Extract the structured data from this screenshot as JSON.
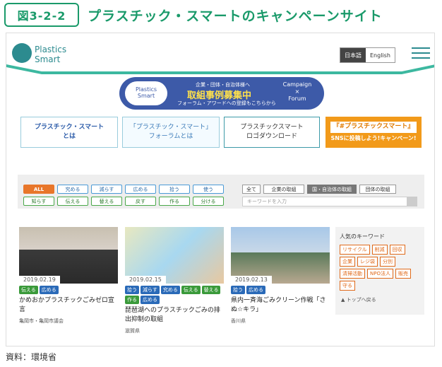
{
  "figure": {
    "label": "図3-2-2",
    "title": "プラスチック・スマートのキャンペーンサイト",
    "source": "資料：環境省"
  },
  "header": {
    "logo_line1": "Plastics",
    "logo_line2": "Smart",
    "lang": [
      "日本語",
      "English"
    ]
  },
  "banner": {
    "line1": "企業・団体・自治体様へ",
    "line2": "取組事例募集中",
    "line3": "フォーラム・アワードへの登録もこちらから",
    "logo1": "Plastics",
    "logo2": "Smart",
    "right1": "Campaign",
    "right2": "×",
    "right3": "Forum"
  },
  "tiles": [
    {
      "line1": "プラスチック・スマート",
      "line2": "とは"
    },
    {
      "line1": "「プラスチック・スマート」",
      "line2": "フォーラムとは"
    },
    {
      "line1": "プラスチックスマート",
      "line2": "ロゴダウンロード"
    },
    {
      "line1": "『#プラスチックスマート』",
      "line2": "SNSに投稿しよう!キャンペーン!"
    }
  ],
  "filters": {
    "row1": [
      "ALL",
      "究める",
      "減らす",
      "広める",
      "拾う",
      "使う"
    ],
    "row2": [
      "知らす",
      "伝える",
      "替える",
      "戻す",
      "作る",
      "分ける"
    ],
    "categories": [
      "全て",
      "企業の取組",
      "国・自治体の取組",
      "団体の取組"
    ],
    "keyword_placeholder": "キーワードを入力"
  },
  "cards": [
    {
      "date": "2019.02.19",
      "tags": [
        "伝える",
        "広める"
      ],
      "title": "かめおかプラスチックごみゼロ宣言",
      "org": "亀岡市・亀岡市議会"
    },
    {
      "date": "2019.02.15",
      "tags": [
        "拾う",
        "減らす",
        "究める",
        "伝える",
        "替える",
        "作る",
        "広める"
      ],
      "title": "琵琶湖へのプラスチックごみの排出抑制の取組",
      "org": "滋賀県"
    },
    {
      "date": "2019.02.13",
      "tags": [
        "拾う",
        "広める"
      ],
      "title": "県内一斉海ごみクリーン作戦「さぬ☆キラ」",
      "org": "香川県"
    }
  ],
  "sidebar": {
    "heading": "人気のキーワード",
    "keywords": [
      "リサイクル",
      "削減",
      "回収",
      "企業",
      "レジ袋",
      "分別",
      "清掃活動",
      "NPO法人",
      "販売",
      "守る"
    ],
    "to_top": "▲ トップへ戻る"
  },
  "colors": {
    "green": "#1a9a6a",
    "teal": "#2c8b8f",
    "navy": "#3d5aa8",
    "orange": "#e8762a",
    "tag_green": "#3a9a3a",
    "tag_blue": "#2a6ab8"
  }
}
